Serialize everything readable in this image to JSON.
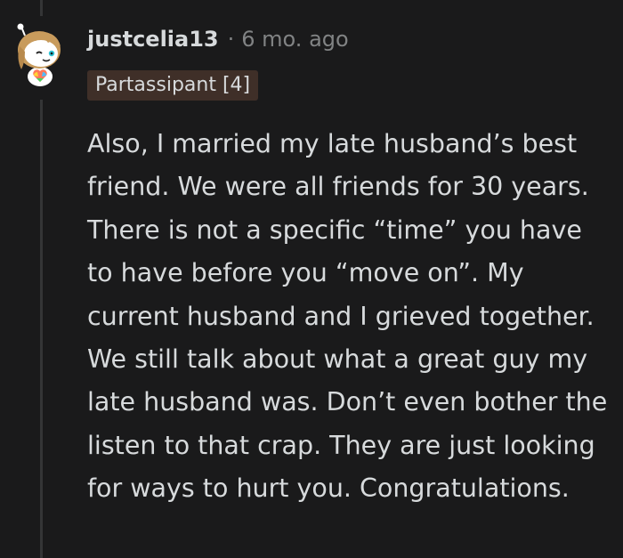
{
  "comment": {
    "author": "justcelia13",
    "separator": "·",
    "timestamp": "6 mo. ago",
    "flair": "Partassipant [4]",
    "body": "Also, I married my late husband’s best friend. We were all friends for 30 years. There is not a specific “time” you have to have before you “move on”. My current husband and I grieved together. We still talk about what a great guy my late husband was. Don’t even bother the listen to that crap. They are just looking for ways to hurt you. Congratulations."
  },
  "colors": {
    "background": "#1a1a1b",
    "text": "#d7dadc",
    "meta": "#818384",
    "flair_bg": "#3f2f28",
    "thread_line": "#343536"
  }
}
